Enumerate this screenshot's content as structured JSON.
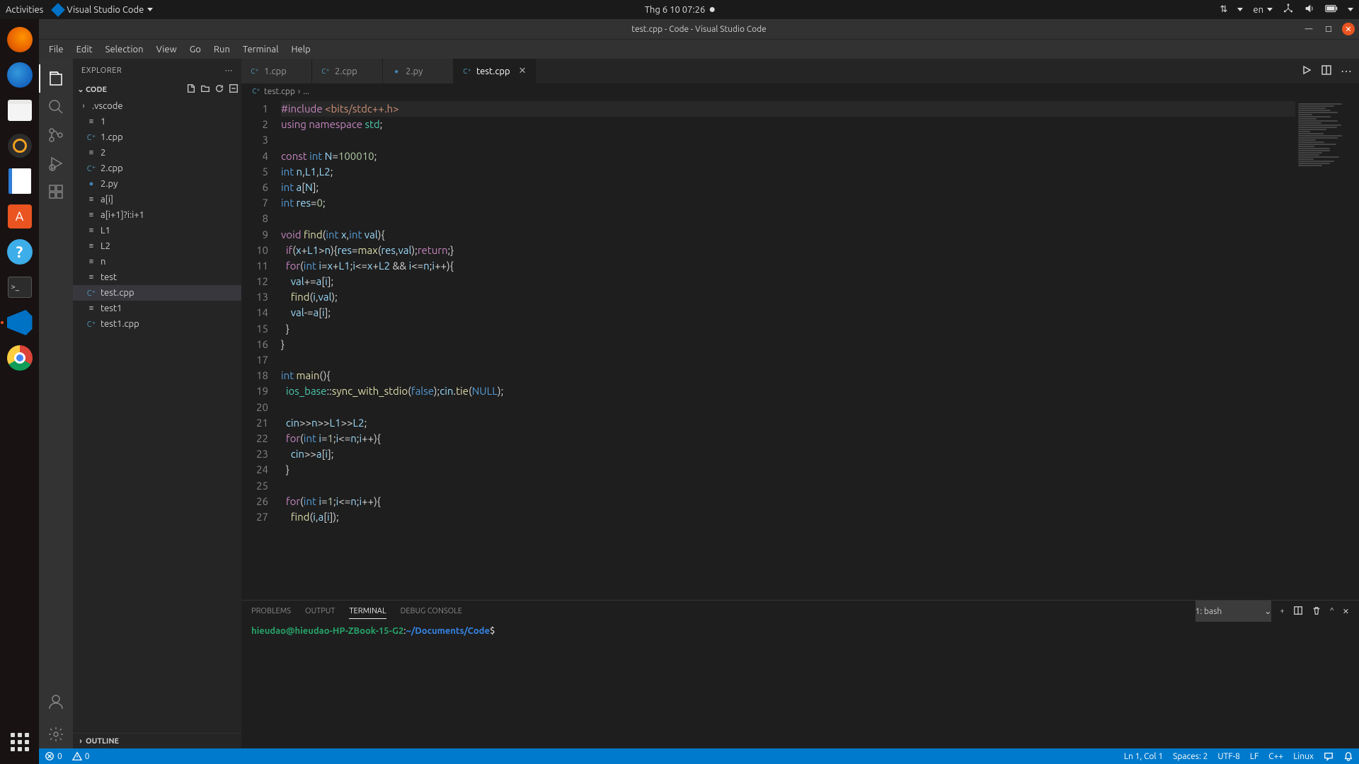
{
  "gnome": {
    "activities": "Activities",
    "app": "Visual Studio Code",
    "clock": "Thg 6 10  07:26",
    "lang": "en"
  },
  "titlebar": "test.cpp - Code - Visual Studio Code",
  "menu": [
    "File",
    "Edit",
    "Selection",
    "View",
    "Go",
    "Run",
    "Terminal",
    "Help"
  ],
  "sidebar": {
    "title": "EXPLORER",
    "root": "CODE",
    "items": [
      {
        "label": ".vscode",
        "type": "folder"
      },
      {
        "label": "1",
        "type": "file"
      },
      {
        "label": "1.cpp",
        "type": "file"
      },
      {
        "label": "2",
        "type": "file"
      },
      {
        "label": "2.cpp",
        "type": "file"
      },
      {
        "label": "2.py",
        "type": "file"
      },
      {
        "label": "a[i]",
        "type": "file"
      },
      {
        "label": "a[i+1]?i:i+1",
        "type": "file"
      },
      {
        "label": "L1",
        "type": "file"
      },
      {
        "label": "L2",
        "type": "file"
      },
      {
        "label": "n",
        "type": "file"
      },
      {
        "label": "test",
        "type": "file"
      },
      {
        "label": "test.cpp",
        "type": "file",
        "selected": true
      },
      {
        "label": "test1",
        "type": "file"
      },
      {
        "label": "test1.cpp",
        "type": "file"
      }
    ],
    "outline": "OUTLINE"
  },
  "tabs": [
    {
      "label": "1.cpp",
      "icon": "cpp"
    },
    {
      "label": "2.cpp",
      "icon": "cpp"
    },
    {
      "label": "2.py",
      "icon": "py"
    },
    {
      "label": "test.cpp",
      "icon": "cpp",
      "active": true
    }
  ],
  "breadcrumb": {
    "file": "test.cpp",
    "sep": "›",
    "rest": "..."
  },
  "code_lines": [
    "#include <bits/stdc++.h>",
    "using namespace std;",
    "",
    "const int N=100010;",
    "int n,L1,L2;",
    "int a[N];",
    "int res=0;",
    "",
    "void find(int x,int val){",
    "  if(x+L1>n){res=max(res,val);return;}",
    "  for(int i=x+L1;i<=x+L2 && i<=n;i++){",
    "    val+=a[i];",
    "    find(i,val);",
    "    val-=a[i];",
    "  }",
    "}",
    "",
    "int main(){",
    "  ios_base::sync_with_stdio(false);cin.tie(NULL);",
    "",
    "  cin>>n>>L1>>L2;",
    "  for(int i=1;i<=n;i++){",
    "    cin>>a[i];",
    "  }",
    "",
    "  for(int i=1;i<=n;i++){",
    "    find(i,a[i]);"
  ],
  "panel": {
    "tabs": [
      "PROBLEMS",
      "OUTPUT",
      "TERMINAL",
      "DEBUG CONSOLE"
    ],
    "active": "TERMINAL",
    "shell": "1: bash",
    "prompt_user": "hieudao@hieudao-HP-ZBook-15-G2",
    "prompt_sep": ":",
    "prompt_path": "~/Documents/Code",
    "prompt_end": "$"
  },
  "status": {
    "errors": "0",
    "warnings": "0",
    "ln": "Ln 1, Col 1",
    "spaces": "Spaces: 2",
    "encoding": "UTF-8",
    "eol": "LF",
    "lang": "C++",
    "os": "Linux"
  }
}
